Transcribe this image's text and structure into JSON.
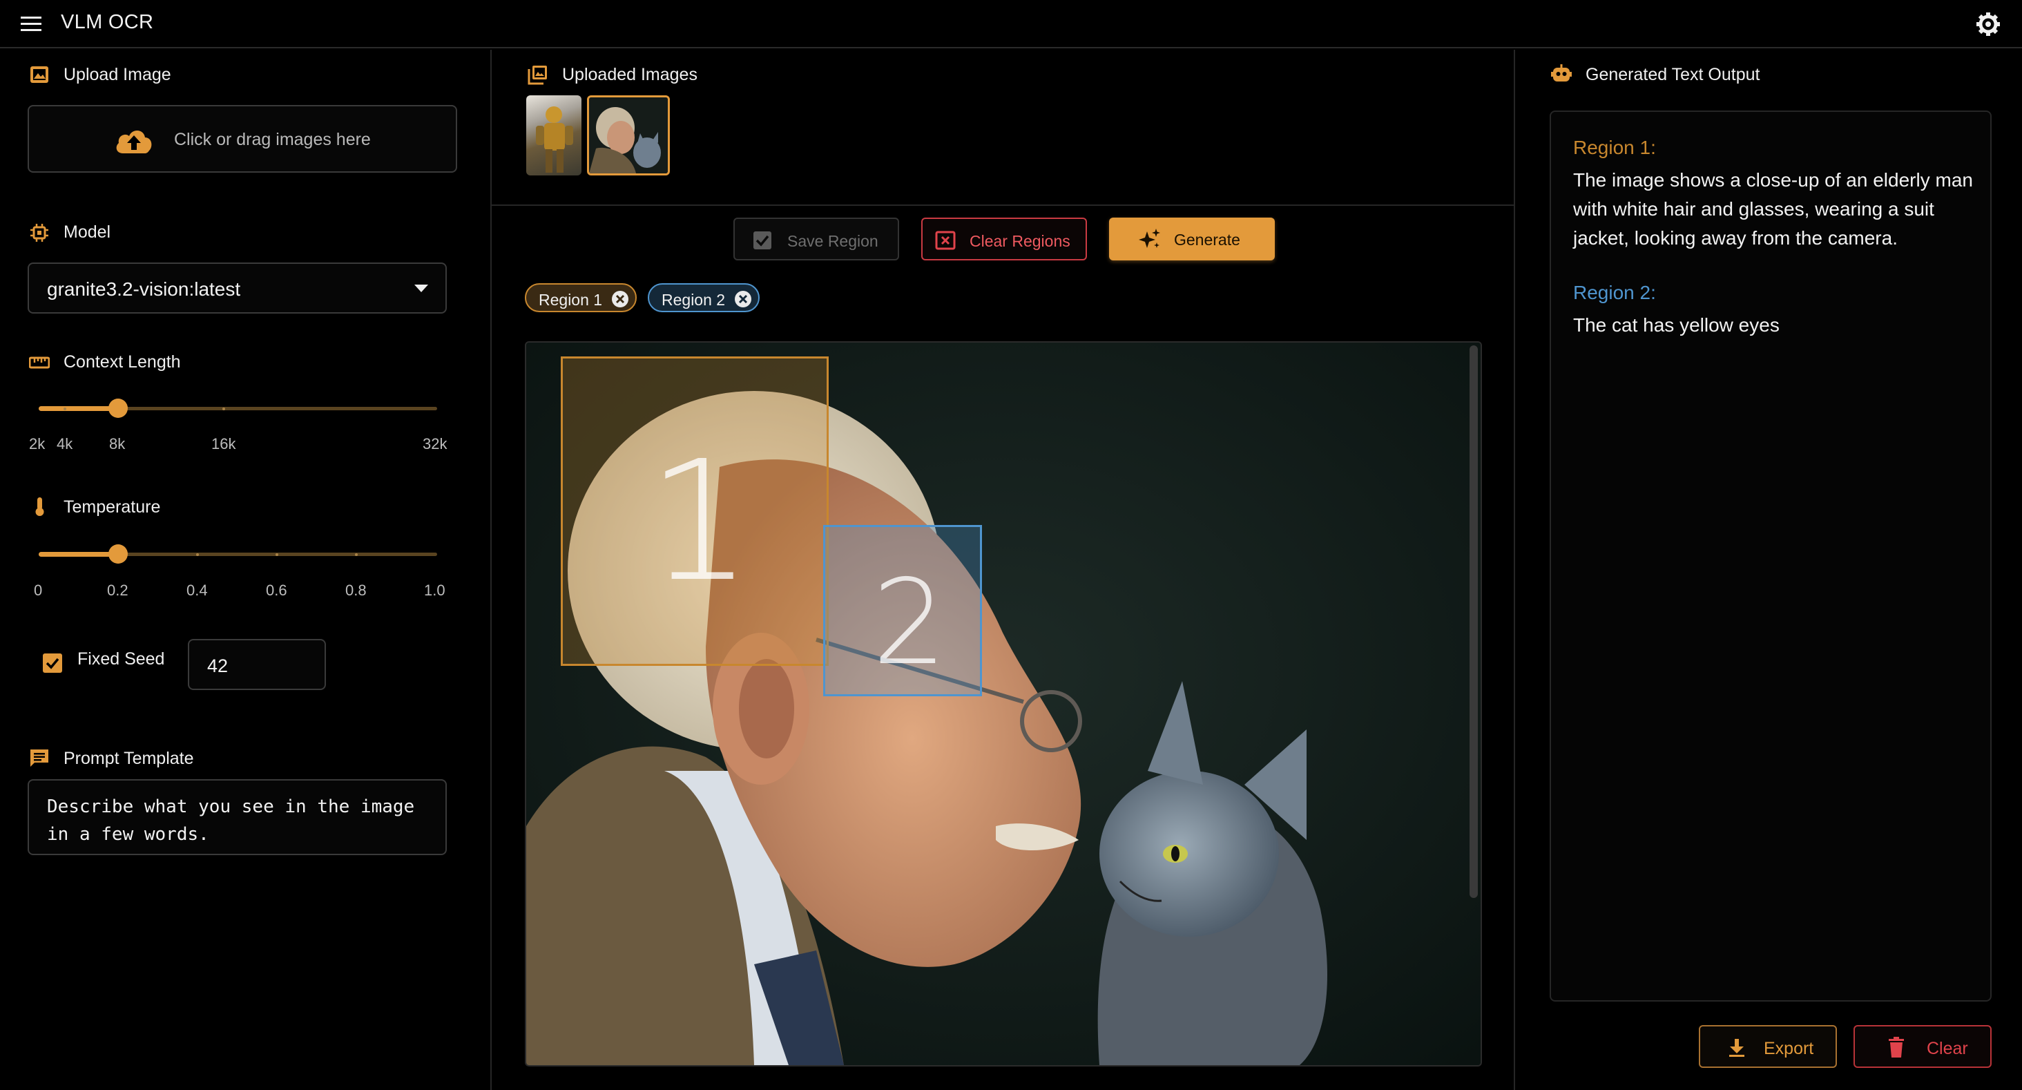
{
  "app": {
    "title": "VLM OCR"
  },
  "left": {
    "upload": {
      "label": "Upload Image",
      "dropzone_text": "Click or drag images here"
    },
    "model": {
      "label": "Model",
      "selected": "granite3.2-vision:latest"
    },
    "context": {
      "label": "Context Length",
      "ticks": [
        "2k",
        "4k",
        "8k",
        "16k",
        "32k"
      ],
      "value": "8k"
    },
    "temperature": {
      "label": "Temperature",
      "ticks": [
        "0",
        "0.2",
        "0.4",
        "0.6",
        "0.8",
        "1.0"
      ],
      "value": 0.2
    },
    "seed": {
      "label": "Fixed Seed",
      "checked": true,
      "value": "42"
    },
    "prompt": {
      "label": "Prompt Template",
      "value": "Describe what you see in the image in a few words."
    }
  },
  "middle": {
    "uploaded_label": "Uploaded Images",
    "toolbar": {
      "save": "Save Region",
      "clear": "Clear Regions",
      "generate": "Generate"
    },
    "chips": [
      {
        "label": "Region 1"
      },
      {
        "label": "Region 2"
      }
    ],
    "regions": [
      {
        "number": "1",
        "color": "#c8872e"
      },
      {
        "number": "2",
        "color": "#4f95cf"
      }
    ]
  },
  "right": {
    "title": "Generated Text Output",
    "results": [
      {
        "label": "Region 1:",
        "text": "The image shows a close-up of an elderly man with white hair and glasses, wearing a suit jacket, looking away from the camera.",
        "color": "#c8872e"
      },
      {
        "label": "Region 2:",
        "text": "The cat has yellow eyes",
        "color": "#4f95cf"
      }
    ],
    "export": "Export",
    "clear": "Clear"
  },
  "colors": {
    "accent": "#e39a3b",
    "danger": "#e0434b",
    "region1": "#c8872e",
    "region2": "#4f95cf"
  }
}
